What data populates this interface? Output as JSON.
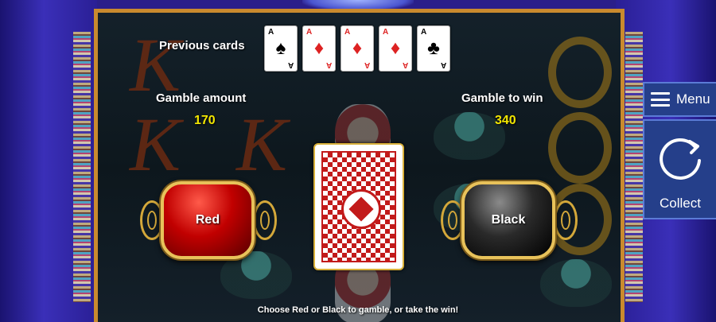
{
  "previous_cards": {
    "label": "Previous cards",
    "cards": [
      {
        "rank": "A",
        "suit": "♠",
        "color": "black"
      },
      {
        "rank": "A",
        "suit": "♦",
        "color": "red"
      },
      {
        "rank": "A",
        "suit": "♦",
        "color": "red"
      },
      {
        "rank": "A",
        "suit": "♦",
        "color": "red"
      },
      {
        "rank": "A",
        "suit": "♣",
        "color": "black"
      }
    ]
  },
  "gamble_amount": {
    "label": "Gamble amount",
    "value": "170"
  },
  "gamble_to_win": {
    "label": "Gamble to win",
    "value": "340"
  },
  "buttons": {
    "red": "Red",
    "black": "Black"
  },
  "hint": "Choose Red or Black to gamble, or take the win!",
  "side_panel": {
    "menu_label": "Menu",
    "collect_label": "Collect"
  },
  "colors": {
    "value_yellow": "#f2e600",
    "frame_gold": "#c98a2e",
    "panel_blue": "#253f8a"
  },
  "icons": [
    "hamburger-menu-icon",
    "collect-circular-arrow-icon"
  ]
}
